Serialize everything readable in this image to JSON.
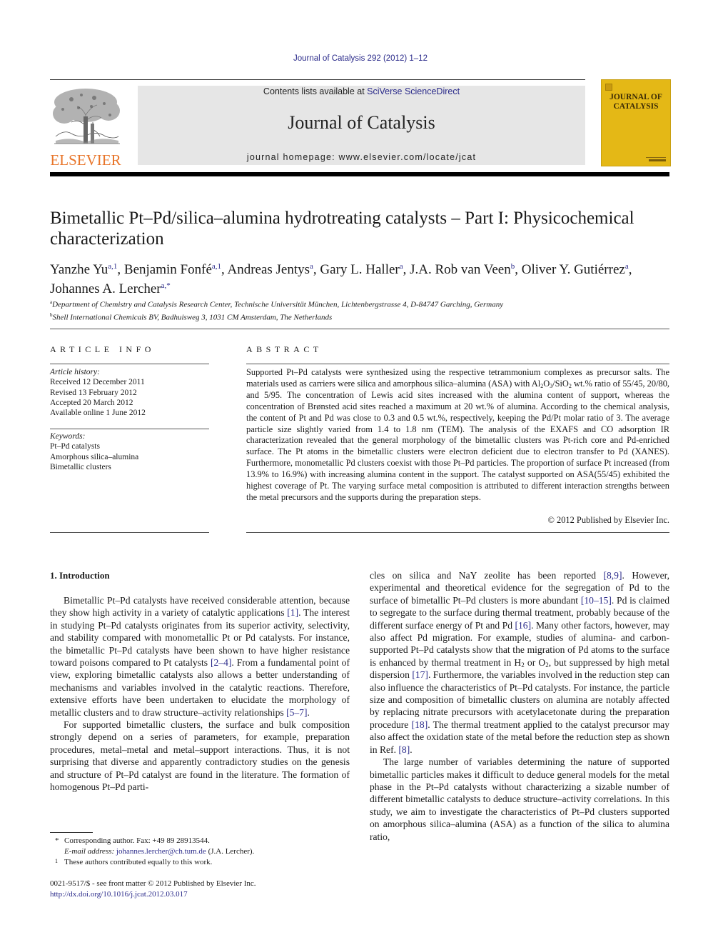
{
  "header": {
    "journal_ref": "Journal of Catalysis 292 (2012) 1–12",
    "contents_prefix": "Contents lists available at ",
    "contents_link": "SciVerse ScienceDirect",
    "journal_title": "Journal of Catalysis",
    "homepage": "journal homepage: www.elsevier.com/locate/jcat",
    "publisher_logo_text": "ELSEVIER",
    "cover_title_line1": "JOURNAL OF",
    "cover_title_line2": "CATALYSIS",
    "colors": {
      "link": "#2a2a8a",
      "elsevier_orange": "#e8752a",
      "cover_yellow": "#e4b816",
      "banner_gray": "#e6e6e6"
    }
  },
  "article": {
    "title": "Bimetallic Pt–Pd/silica–alumina hydrotreating catalysts – Part I: Physicochemical characterization",
    "authors": [
      {
        "name": "Yanzhe Yu",
        "sup": "a,1",
        "sep": ", "
      },
      {
        "name": "Benjamin Fonfé",
        "sup": "a,1",
        "sep": ", "
      },
      {
        "name": "Andreas Jentys",
        "sup": "a",
        "sep": ", "
      },
      {
        "name": "Gary L. Haller",
        "sup": "a",
        "sep": ", "
      },
      {
        "name": "J.A. Rob van Veen",
        "sup": "b",
        "sep": ", "
      },
      {
        "name": "Oliver Y. Gutiérrez",
        "sup": "a",
        "sep": ", "
      },
      {
        "name": "Johannes A. Lercher",
        "sup": "a,*",
        "sep": ""
      }
    ],
    "affiliations": [
      {
        "mark": "a",
        "text": "Department of Chemistry and Catalysis Research Center, Technische Universität München, Lichtenbergstrasse 4, D-84747 Garching, Germany"
      },
      {
        "mark": "b",
        "text": "Shell International Chemicals BV, Badhuisweg 3, 1031 CM Amsterdam, The Netherlands"
      }
    ]
  },
  "article_info": {
    "heading": "ARTICLE INFO",
    "history_label": "Article history:",
    "history": [
      "Received 12 December 2011",
      "Revised 13 February 2012",
      "Accepted 20 March 2012",
      "Available online 1 June 2012"
    ],
    "keywords_label": "Keywords:",
    "keywords": [
      "Pt–Pd catalysts",
      "Amorphous silica–alumina",
      "Bimetallic clusters"
    ]
  },
  "abstract": {
    "heading": "ABSTRACT",
    "part1": "Supported Pt–Pd catalysts were synthesized using the respective tetrammonium complexes as precursor salts. The materials used as carriers were silica and amorphous silica–alumina (ASA) with Al",
    "sub1": "2",
    "part2": "O",
    "sub2": "3",
    "part3": "/SiO",
    "sub3": "2",
    "part4": " wt.% ratio of 55/45, 20/80, and 5/95. The concentration of Lewis acid sites increased with the alumina content of support, whereas the concentration of Brønsted acid sites reached a maximum at 20 wt.% of alumina. According to the chemical analysis, the content of Pt and Pd was close to 0.3 and 0.5 wt.%, respectively, keeping the Pd/Pt molar ratio of 3. The average particle size slightly varied from 1.4 to 1.8 nm (TEM). The analysis of the EXAFS and CO adsorption IR characterization revealed that the general morphology of the bimetallic clusters was Pt-rich core and Pd-enriched surface. The Pt atoms in the bimetallic clusters were electron deficient due to electron transfer to Pd (XANES). Furthermore, monometallic Pd clusters coexist with those Pt–Pd particles. The proportion of surface Pt increased (from 13.9% to 16.9%) with increasing alumina content in the support. The catalyst supported on ASA(55/45) exhibited the highest coverage of Pt. The varying surface metal composition is attributed to different interaction strengths between the metal precursors and the supports during the preparation steps.",
    "copyright": "© 2012 Published by Elsevier Inc."
  },
  "intro": {
    "heading": "1. Introduction",
    "left": {
      "p1a": "Bimetallic Pt–Pd catalysts have received considerable attention, because they show high activity in a variety of catalytic applications ",
      "p1_ref1": "[1]",
      "p1b": ". The interest in studying Pt–Pd catalysts originates from its superior activity, selectivity, and stability compared with monometallic Pt or Pd catalysts. For instance, the bimetallic Pt–Pd catalysts have been shown to have higher resistance toward poisons compared to Pt catalysts ",
      "p1_ref2": "[2–4]",
      "p1c": ". From a fundamental point of view, exploring bimetallic catalysts also allows a better understanding of mechanisms and variables involved in the catalytic reactions. Therefore, extensive efforts have been undertaken to elucidate the morphology of metallic clusters and to draw structure–activity relationships ",
      "p1_ref3": "[5–7]",
      "p1d": ".",
      "p2": "For supported bimetallic clusters, the surface and bulk composition strongly depend on a series of parameters, for example, preparation procedures, metal–metal and metal–support interactions. Thus, it is not surprising that diverse and apparently contradictory studies on the genesis and structure of Pt–Pd catalyst are found in the literature. The formation of homogenous Pt–Pd parti-"
    },
    "right": {
      "p1a": "cles on silica and NaY zeolite has been reported ",
      "ref1": "[8,9]",
      "p1b": ". However, experimental and theoretical evidence for the segregation of Pd to the surface of bimetallic Pt–Pd clusters is more abundant ",
      "ref2": "[10–15]",
      "p1c": ". Pd is claimed to segregate to the surface during thermal treatment, probably because of the different surface energy of Pt and Pd ",
      "ref3": "[16]",
      "p1d": ". Many other factors, however, may also affect Pd migration. For example, studies of alumina- and carbon-supported Pt–Pd catalysts show that the migration of Pd atoms to the surface is enhanced by thermal treatment in H",
      "sub_h": "2",
      "p1e": " or O",
      "sub_o": "2",
      "p1f": ", but suppressed by high metal dispersion ",
      "ref4": "[17]",
      "p1g": ". Furthermore, the variables involved in the reduction step can also influence the characteristics of Pt–Pd catalysts. For instance, the particle size and composition of bimetallic clusters on alumina are notably affected by replacing nitrate precursors with acetylacetonate during the preparation procedure ",
      "ref5": "[18]",
      "p1h": ". The thermal treatment applied to the catalyst precursor may also affect the oxidation state of the metal before the reduction step as shown in Ref. ",
      "ref6": "[8]",
      "p1i": ".",
      "p2": "The large number of variables determining the nature of supported bimetallic particles makes it difficult to deduce general models for the metal phase in the Pt–Pd catalysts without characterizing a sizable number of different bimetallic catalysts to deduce structure–activity correlations. In this study, we aim to investigate the characteristics of Pt–Pd clusters supported on amorphous silica–alumina (ASA) as a function of the silica to alumina ratio,"
    }
  },
  "footnotes": {
    "star_mark": "*",
    "corresponding": "Corresponding author. Fax: +49 89 28913544.",
    "email_label": "E-mail address: ",
    "email": "johannes.lercher@ch.tum.de",
    "email_suffix": " (J.A. Lercher).",
    "one_mark": "1",
    "equal": "These authors contributed equally to this work."
  },
  "front_matter": {
    "issn_line": "0021-9517/$ - see front matter © 2012 Published by Elsevier Inc.",
    "doi": "http://dx.doi.org/10.1016/j.jcat.2012.03.017"
  }
}
